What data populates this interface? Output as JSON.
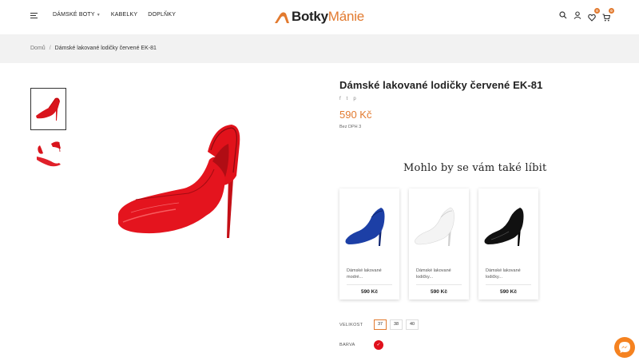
{
  "header": {
    "nav": [
      {
        "label": "DÁMSKÉ BOTY",
        "has_dropdown": true
      },
      {
        "label": "KABELKY",
        "has_dropdown": false
      },
      {
        "label": "DOPLŇKY",
        "has_dropdown": false
      }
    ],
    "logo": {
      "part1": "Botky",
      "part2": "Mánie"
    },
    "wishlist_count": "0",
    "cart_count": "0"
  },
  "breadcrumb": {
    "home": "Domů",
    "separator": "/",
    "current": "Dámské lakované lodičky červené EK-81"
  },
  "product": {
    "title": "Dámské lakované lodičky červené EK-81",
    "price": "590 Kč",
    "tax_note": "Bez DPH 3",
    "social": [
      "f",
      "t",
      "p"
    ]
  },
  "recommendations": {
    "title": "Mohlo by se vám také líbit",
    "items": [
      {
        "name": "Dámské lakované modré...",
        "price": "590 Kč",
        "color": "#1c3fa6"
      },
      {
        "name": "Dámské lakované lodičky...",
        "price": "590 Kč",
        "color": "#f2f2f2"
      },
      {
        "name": "Dámské lakované lodičky...",
        "price": "590 Kč",
        "color": "#111111"
      }
    ]
  },
  "options": {
    "size_label": "VELIKOST",
    "sizes": [
      "37",
      "38",
      "40"
    ],
    "selected_size": "37",
    "color_label": "BARVA",
    "color_value": "#e0101c",
    "color_check": "✓"
  },
  "colors": {
    "accent": "#e27a2f",
    "product": "#e0101c"
  }
}
